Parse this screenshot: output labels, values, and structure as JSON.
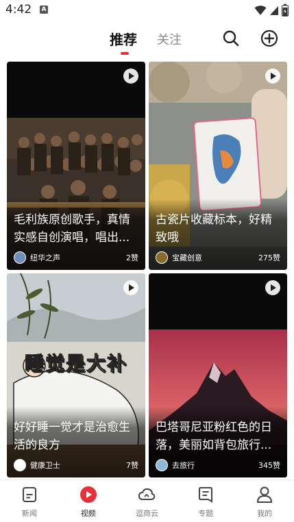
{
  "status": {
    "time": "4:42",
    "notif_letter": "A"
  },
  "header": {
    "tab_recommend": "推荐",
    "tab_follow": "关注"
  },
  "cards": [
    {
      "title": "毛利族原创歌手，真情实感自创演唱，唱出...",
      "author": "纽华之声",
      "likes": "2赞"
    },
    {
      "title": "古瓷片收藏标本，好精致哦",
      "author": "宝藏创意",
      "likes": "275赞"
    },
    {
      "title": "好好睡一觉才是治愈生活的良方",
      "author": "健康卫士",
      "likes": "7赞",
      "overlay_text": "睡觉是大补"
    },
    {
      "title": "巴塔哥尼亚粉红色的日落，美丽如背包旅行...",
      "author": "去旅行",
      "likes": "345赞"
    }
  ],
  "nav": [
    {
      "label": "新闻"
    },
    {
      "label": "视频"
    },
    {
      "label": "逗商云"
    },
    {
      "label": "专题"
    },
    {
      "label": "我的"
    }
  ],
  "colors": {
    "accent": "#e8303a",
    "inactive": "#777777"
  }
}
